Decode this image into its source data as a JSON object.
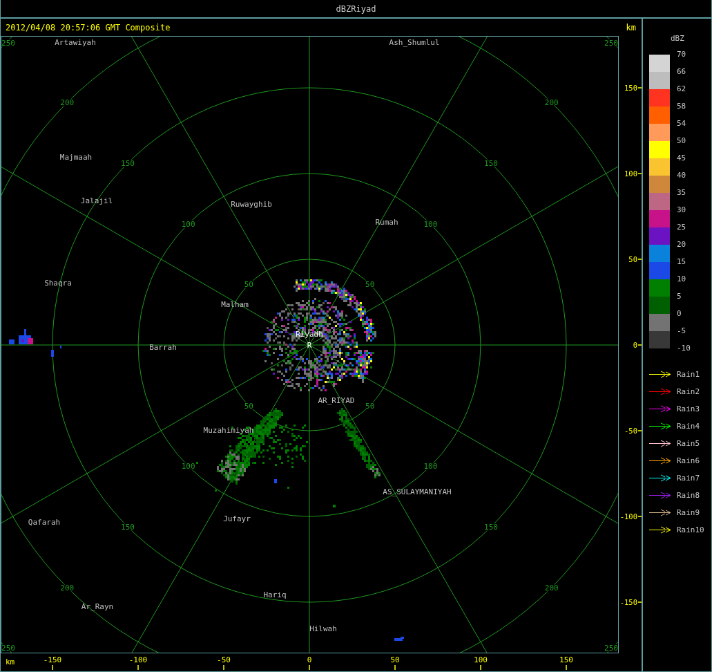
{
  "window": {
    "title": "dBZRiyad"
  },
  "header": {
    "timestamp": "2012/04/08 20:57:06 GMT Composite",
    "unit": "km"
  },
  "plot": {
    "center_label": "Riyadh",
    "center_marker": "R",
    "rings": [
      {
        "labels": [
          "50",
          "50",
          "50",
          "50"
        ]
      },
      {
        "labels": [
          "100",
          "100",
          "100",
          "100"
        ]
      },
      {
        "labels": [
          "150",
          "150",
          "150",
          "150"
        ]
      },
      {
        "labels": [
          "200",
          "200",
          "200",
          "200"
        ]
      },
      {
        "labels": [
          "250",
          "250",
          "250",
          "250"
        ]
      }
    ],
    "places": [
      "Artawiyah",
      "Ash_Shumlul",
      "Majmaah",
      "Jalajil",
      "Ruwayghib",
      "Rumah",
      "Shaqra",
      "Malham",
      "Barrah",
      "AR_RIYAD",
      "Muzahimiyah",
      "AS_SULAYMANIYAH",
      "Qafarah",
      "Jufayr",
      "Hariq",
      "Ar_Rayn",
      "Hilwah"
    ]
  },
  "y_axis": {
    "ticks": [
      "150",
      "100",
      "50",
      "0",
      "-50",
      "-100",
      "-150"
    ]
  },
  "x_axis": {
    "unit": "km",
    "ticks": [
      "-150",
      "-100",
      "-50",
      "0",
      "50",
      "100",
      "150"
    ]
  },
  "legend": {
    "unit": "dBZ",
    "labels": [
      "70",
      "66",
      "62",
      "58",
      "54",
      "50",
      "45",
      "40",
      "35",
      "30",
      "25",
      "20",
      "15",
      "10",
      "5",
      "0",
      "-5",
      "-10"
    ],
    "bins": [
      {
        "color": "#d4d4d4"
      },
      {
        "color": "#bdbdbd"
      },
      {
        "color": "#ff3320"
      },
      {
        "color": "#ff5f00"
      },
      {
        "color": "#ff9a5a"
      },
      {
        "color": "#ffff00"
      },
      {
        "color": "#f9c42f"
      },
      {
        "color": "#cf873b"
      },
      {
        "color": "#bd6785"
      },
      {
        "color": "#c8128a"
      },
      {
        "color": "#6b12c3"
      },
      {
        "color": "#0a82dc"
      },
      {
        "color": "#1b49e8"
      },
      {
        "color": "#007f00"
      },
      {
        "color": "#005f00"
      },
      {
        "color": "#737373"
      },
      {
        "color": "#383838"
      }
    ],
    "tracks": [
      {
        "label": "Rain1",
        "color": "#ffff00"
      },
      {
        "label": "Rain2",
        "color": "#ff0000"
      },
      {
        "label": "Rain3",
        "color": "#ff00ff"
      },
      {
        "label": "Rain4",
        "color": "#00ff00"
      },
      {
        "label": "Rain5",
        "color": "#ffc0cb"
      },
      {
        "label": "Rain6",
        "color": "#ffa500"
      },
      {
        "label": "Rain7",
        "color": "#00ffff"
      },
      {
        "label": "Rain8",
        "color": "#a020f0"
      },
      {
        "label": "Rain9",
        "color": "#d2b48c"
      },
      {
        "label": "Rain10",
        "color": "#ffff00"
      }
    ]
  }
}
